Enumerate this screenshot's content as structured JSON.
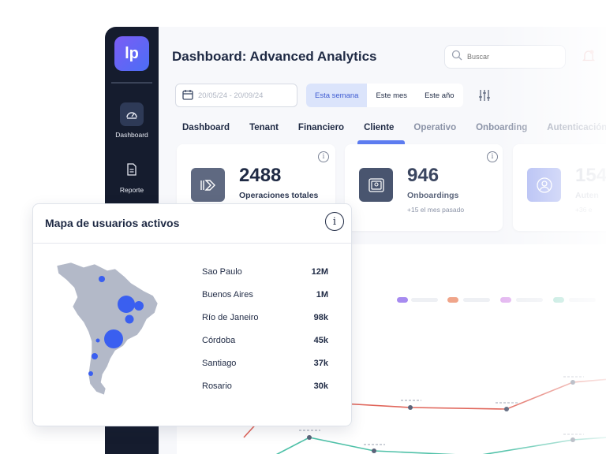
{
  "sidebar": {
    "logo": "lp",
    "items": [
      {
        "label": "Dashboard",
        "icon": "gauge-icon"
      },
      {
        "label": "Reporte",
        "icon": "document-icon"
      }
    ]
  },
  "header": {
    "title": "Dashboard: Advanced Analytics",
    "search_placeholder": "Buscar"
  },
  "filters": {
    "date_range": "20/05/24 - 20/09/24",
    "periods": [
      "Esta semana",
      "Este mes",
      "Este año"
    ],
    "active_period": "Esta semana"
  },
  "tabs": [
    "Dashboard",
    "Tenant",
    "Financiero",
    "Cliente",
    "Operativo",
    "Onboarding",
    "Autenticación"
  ],
  "active_tab": "Cliente",
  "stats": [
    {
      "value": "2488",
      "label": "Operaciones totales",
      "sub": ""
    },
    {
      "value": "946",
      "label": "Onboardings",
      "sub": "+15 el mes pasado"
    },
    {
      "value": "154",
      "label": "Auten",
      "sub": "+36 e"
    }
  ],
  "map_card": {
    "title": "Mapa de usuarios activos",
    "cities": [
      {
        "name": "Sao Paulo",
        "value": "12M"
      },
      {
        "name": "Buenos Aires",
        "value": "1M"
      },
      {
        "name": "Río de Janeiro",
        "value": "98k"
      },
      {
        "name": "Córdoba",
        "value": "45k"
      },
      {
        "name": "Santiago",
        "value": "37k"
      },
      {
        "name": "Rosario",
        "value": "30k"
      }
    ]
  },
  "colors": {
    "accent": "#5d7cf0",
    "sidebar": "#151c2e",
    "marker": "#3a5ff0",
    "map_fill": "#b3b9c8",
    "line_red": "#e0655a",
    "line_teal": "#4fc1a8"
  }
}
